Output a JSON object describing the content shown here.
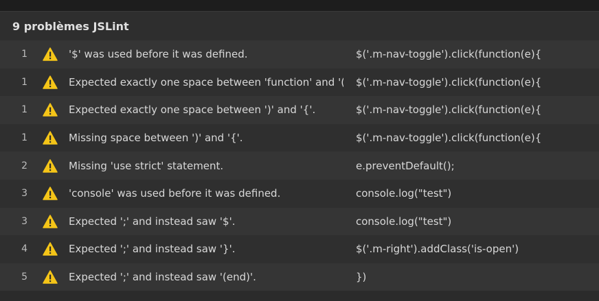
{
  "panel": {
    "title": "9 problèmes JSLint"
  },
  "problems": [
    {
      "line": "1",
      "message": "'$' was used before it was defined.",
      "code": "$('.m-nav-toggle').click(function(e){"
    },
    {
      "line": "1",
      "message": "Expected exactly one space between 'function' and '('.",
      "code": "$('.m-nav-toggle').click(function(e){"
    },
    {
      "line": "1",
      "message": "Expected exactly one space between ')' and '{'.",
      "code": "$('.m-nav-toggle').click(function(e){"
    },
    {
      "line": "1",
      "message": "Missing space between ')' and '{'.",
      "code": "$('.m-nav-toggle').click(function(e){"
    },
    {
      "line": "2",
      "message": "Missing 'use strict' statement.",
      "code": "e.preventDefault();"
    },
    {
      "line": "3",
      "message": "'console' was used before it was defined.",
      "code": "console.log(\"test\")"
    },
    {
      "line": "3",
      "message": "Expected ';' and instead saw '$'.",
      "code": "console.log(\"test\")"
    },
    {
      "line": "4",
      "message": "Expected ';' and instead saw '}'.",
      "code": "$('.m-right').addClass('is-open')"
    },
    {
      "line": "5",
      "message": "Expected ';' and instead saw '(end)'.",
      "code": "})"
    }
  ],
  "colors": {
    "warning": "#f5c518",
    "background": "#2b2b2b"
  },
  "icons": {
    "row_icon": "warning-icon"
  }
}
